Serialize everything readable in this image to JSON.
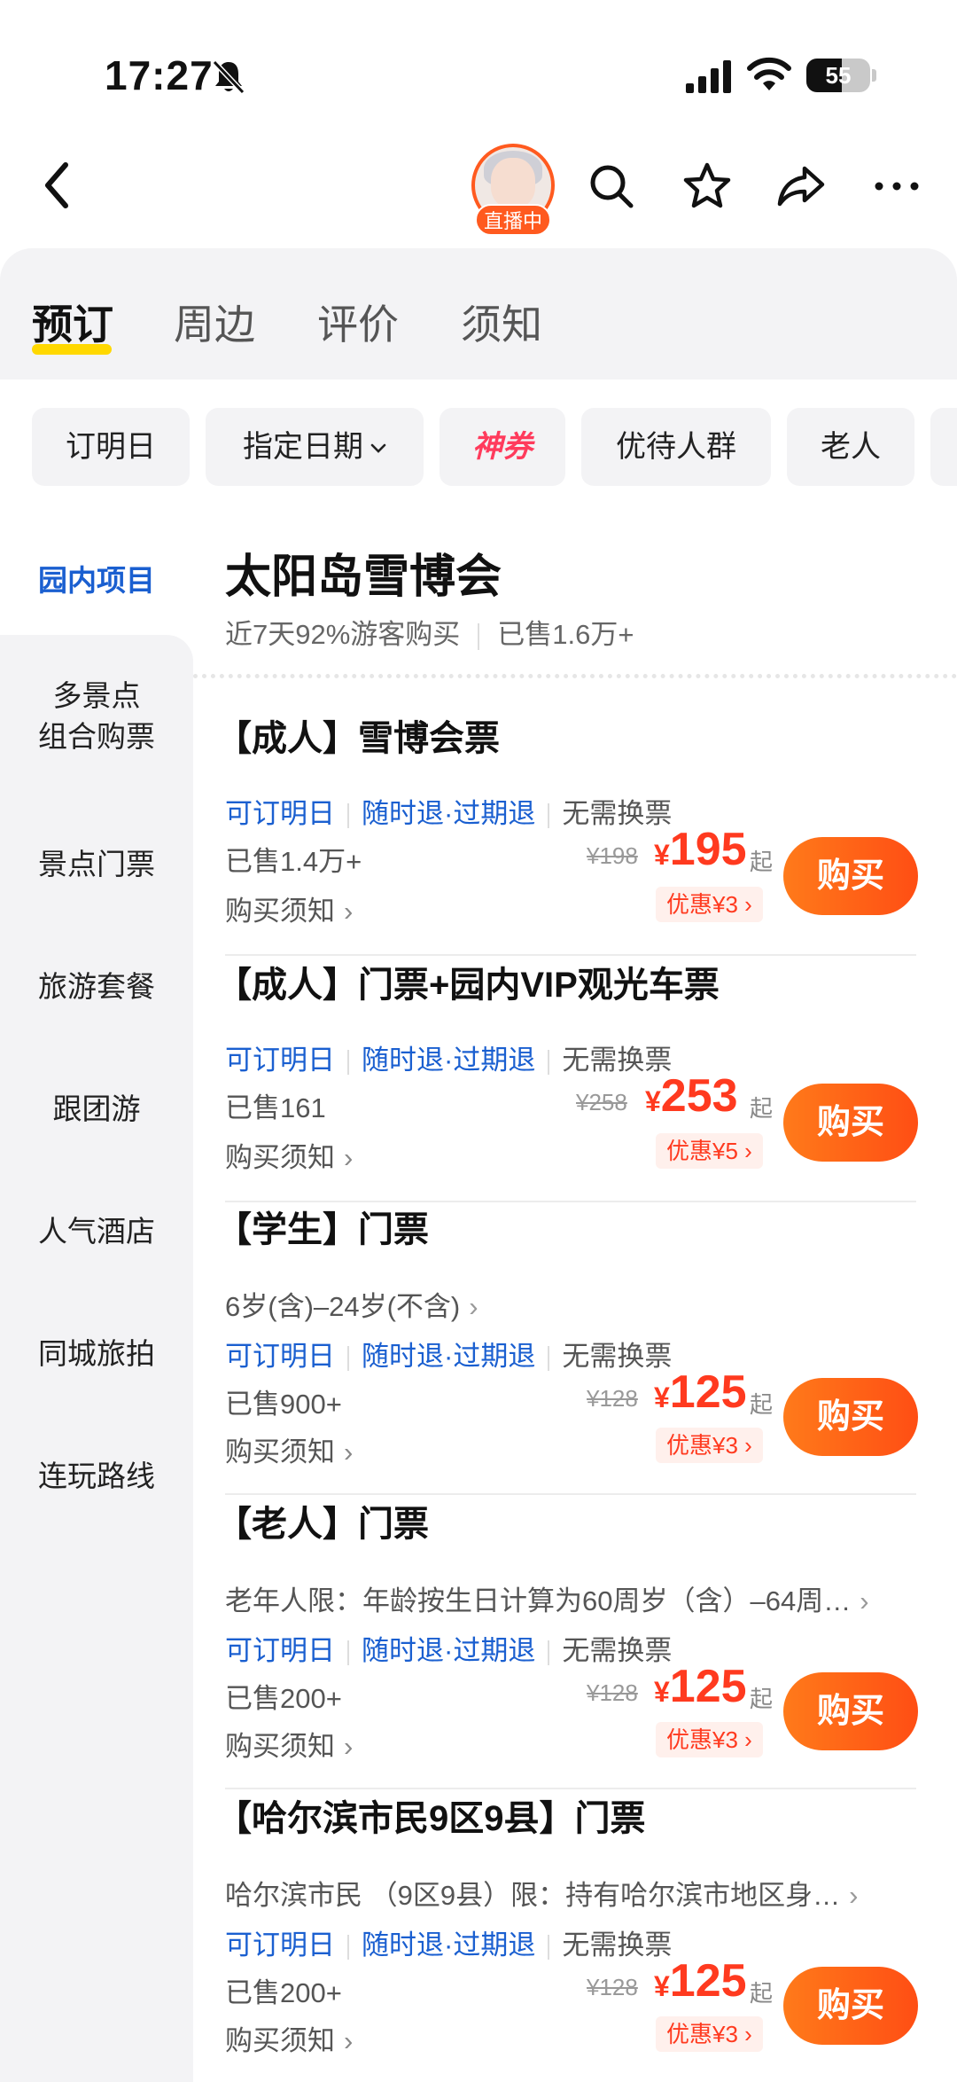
{
  "status_bar": {
    "time": "17:27",
    "battery_level": "55"
  },
  "top_nav": {
    "live_badge": "直播中"
  },
  "tabs": [
    {
      "label": "预订",
      "active": true
    },
    {
      "label": "周边",
      "active": false
    },
    {
      "label": "评价",
      "active": false
    },
    {
      "label": "须知",
      "active": false
    }
  ],
  "filters": {
    "tomorrow": "订明日",
    "date_picker": "指定日期",
    "coupon": "神券",
    "special_group": "优待人群",
    "senior": "老人"
  },
  "sidebar": {
    "items": [
      {
        "label": "园内项目",
        "active": true
      },
      {
        "label": "多景点\n组合购票",
        "active": false
      },
      {
        "label": "景点门票",
        "active": false
      },
      {
        "label": "旅游套餐",
        "active": false
      },
      {
        "label": "跟团游",
        "active": false
      },
      {
        "label": "人气酒店",
        "active": false
      },
      {
        "label": "同城旅拍",
        "active": false
      },
      {
        "label": "连玩路线",
        "active": false
      }
    ]
  },
  "attraction": {
    "name": "太阳岛雪博会",
    "recent_stat": "近7天92%游客购买",
    "total_sold": "已售1.6万+"
  },
  "common": {
    "tag_tomorrow": "可订明日",
    "tag_refund": "随时退·过期退",
    "tag_no_exchange": "无需换票",
    "notice": "购买须知",
    "buy": "购买",
    "from": "起",
    "yen": "¥"
  },
  "products": [
    {
      "title": "【成人】雪博会票",
      "subtitle": "",
      "sold": "已售1.4万+",
      "original_price": "¥198",
      "price": "195",
      "discount": "优惠¥3"
    },
    {
      "title": "【成人】门票+园内VIP观光车票",
      "subtitle": "",
      "sold": "已售161",
      "original_price": "¥258",
      "price": "253",
      "discount": "优惠¥5"
    },
    {
      "title": "【学生】门票",
      "subtitle": "6岁(含)–24岁(不含)",
      "sold": "已售900+",
      "original_price": "¥128",
      "price": "125",
      "discount": "优惠¥3"
    },
    {
      "title": "【老人】门票",
      "subtitle": "老年人限：年龄按生日计算为60周岁（含）–64周…",
      "sold": "已售200+",
      "original_price": "¥128",
      "price": "125",
      "discount": "优惠¥3"
    },
    {
      "title": "【哈尔滨市民9区9县】门票",
      "subtitle": "哈尔滨市民 （9区9县）限：持有哈尔滨市地区身…",
      "sold": "已售200+",
      "original_price": "¥128",
      "price": "125",
      "discount": "优惠¥3"
    }
  ]
}
